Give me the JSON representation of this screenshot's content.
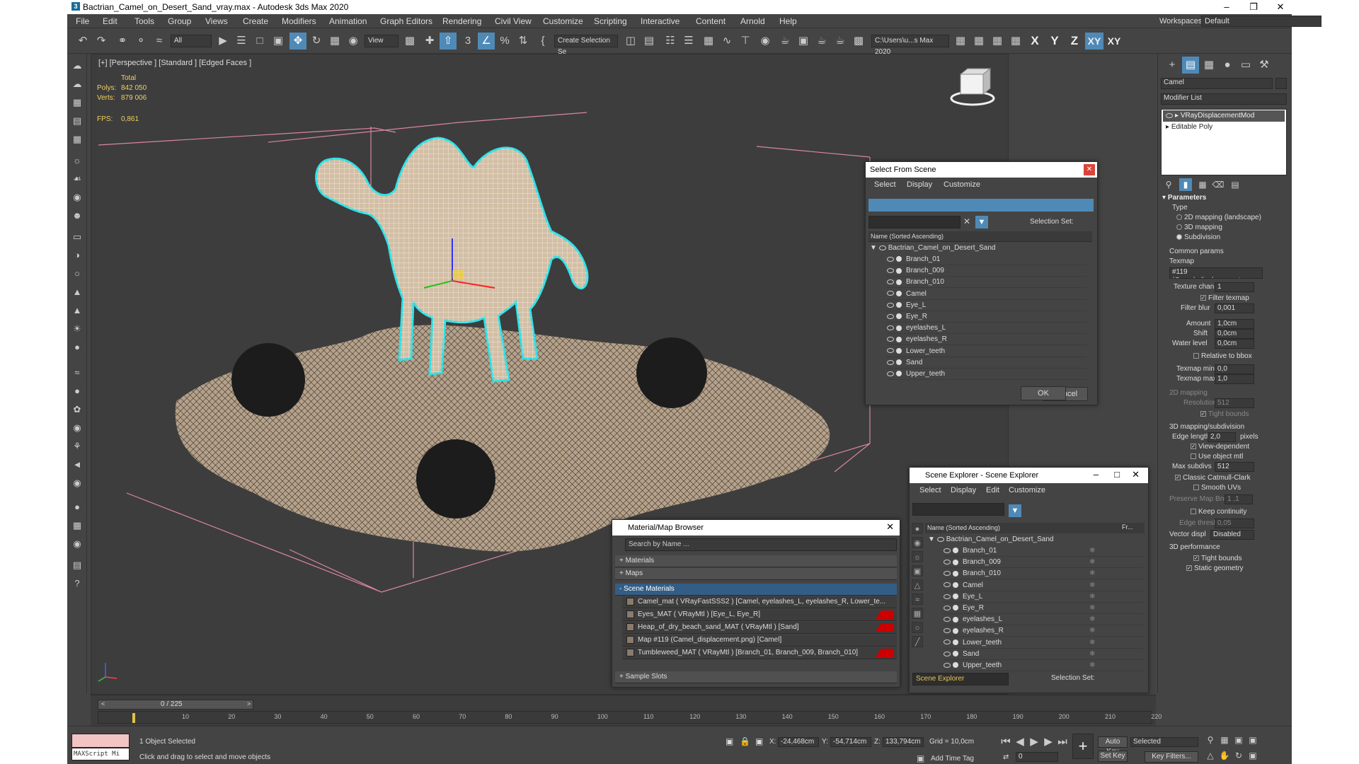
{
  "window": {
    "title": "Bactrian_Camel_on_Desert_Sand_vray.max - Autodesk 3ds Max 2020"
  },
  "menu": [
    "File",
    "Edit",
    "Tools",
    "Group",
    "Views",
    "Create",
    "Modifiers",
    "Animation",
    "Graph Editors",
    "Rendering",
    "Civil View",
    "Customize",
    "Scripting",
    "Interactive",
    "Content",
    "Arnold",
    "Help"
  ],
  "workspace": {
    "label": "Workspaces:",
    "value": "Default"
  },
  "toolbar": {
    "filter": "All",
    "view": "View",
    "selection_set": "Create Selection Se",
    "path": "C:\\Users\\u...s Max 2020",
    "axes": [
      "X",
      "Y",
      "Z",
      "XY",
      "XY"
    ]
  },
  "viewport": {
    "label": "[+] [Perspective ] [Standard ] [Edged Faces ]",
    "stats": {
      "total_label": "Total",
      "polys_label": "Polys:",
      "polys": "842 050",
      "verts_label": "Verts:",
      "verts": "879 006",
      "fps_label": "FPS:",
      "fps": "0,861"
    }
  },
  "select_from_scene": {
    "title": "Select From Scene",
    "menu": [
      "Select",
      "Display",
      "Customize"
    ],
    "selection_set_label": "Selection Set:",
    "column": "Name (Sorted Ascending)",
    "root": "Bactrian_Camel_on_Desert_Sand",
    "items": [
      "Branch_01",
      "Branch_009",
      "Branch_010",
      "Camel",
      "Eye_L",
      "Eye_R",
      "eyelashes_L",
      "eyelashes_R",
      "Lower_teeth",
      "Sand",
      "Upper_teeth"
    ],
    "ok": "OK",
    "cancel": "Cancel"
  },
  "scene_explorer": {
    "title": "Scene Explorer - Scene Explorer",
    "menu": [
      "Select",
      "Display",
      "Edit",
      "Customize"
    ],
    "column": "Name (Sorted Ascending)",
    "column2": "Fr...",
    "root": "Bactrian_Camel_on_Desert_Sand",
    "items": [
      "Branch_01",
      "Branch_009",
      "Branch_010",
      "Camel",
      "Eye_L",
      "Eye_R",
      "eyelashes_L",
      "eyelashes_R",
      "Lower_teeth",
      "Sand",
      "Upper_teeth"
    ],
    "footer": "Scene Explorer",
    "selection_set_label": "Selection Set:"
  },
  "material_browser": {
    "title": "Material/Map Browser",
    "search_placeholder": "Search by Name ...",
    "groups": {
      "materials": "+ Materials",
      "maps": "+ Maps",
      "scene": "- Scene Materials",
      "sample": "+ Sample Slots"
    },
    "scene_materials": [
      "Camel_mat  ( VRayFastSSS2 )  [Camel, eyelashes_L, eyelashes_R, Lower_te...",
      "Eyes_MAT  ( VRayMtl )  [Eye_L, Eye_R]",
      "Heap_of_dry_beach_sand_MAT  ( VRayMtl )  [Sand]",
      "Map #119 (Camel_displacement.png)  [Camel]",
      "Tumbleweed_MAT  ( VRayMtl )  [Branch_01, Branch_009, Branch_010]"
    ]
  },
  "command_panel": {
    "object_name": "Camel",
    "modifier_list": "Modifier List",
    "stack": [
      "VRayDisplacementMod",
      "Editable Poly"
    ],
    "parameters": "Parameters",
    "type_label": "Type",
    "type_options": [
      "2D mapping (landscape)",
      "3D mapping",
      "Subdivision"
    ],
    "common": "Common params",
    "texmap_label": "Texmap",
    "texmap": "#119 (Camel_displacement.p",
    "texture_chan_label": "Texture chan",
    "texture_chan": "1",
    "filter_texmap": "Filter texmap",
    "filter_blur_label": "Filter blur",
    "filter_blur": "0,001",
    "amount_label": "Amount",
    "amount": "1,0cm",
    "shift_label": "Shift",
    "shift": "0,0cm",
    "water_label": "Water level",
    "water": "0,0cm",
    "relative_bbox": "Relative to bbox",
    "texmap_min_label": "Texmap min",
    "texmap_min": "0,0",
    "texmap_max_label": "Texmap max",
    "texmap_max": "1,0",
    "mapping2d": "2D mapping",
    "resolution_label": "Resolution",
    "resolution": "512",
    "tight_bounds": "Tight bounds",
    "mapping3d": "3D mapping/subdivision",
    "edge_length_label": "Edge length",
    "edge_length": "2,0",
    "pixels": "pixels",
    "view_dependent": "View-dependent",
    "use_object_mtl": "Use object mtl",
    "max_subdivs_label": "Max subdivs",
    "max_subdivs": "512",
    "catmull": "Classic Catmull-Clark",
    "smooth_uvs": "Smooth UVs",
    "preserve_label": "Preserve Map Bnd",
    "preserve": "1 ,1",
    "keep_continuity": "Keep continuity",
    "edge_thresh_label": "Edge thresh",
    "edge_thresh": "0,05",
    "vector_label": "Vector displ",
    "vector": "Disabled",
    "perf": "3D performance",
    "tight_bounds2": "Tight bounds",
    "static_geometry": "Static geometry"
  },
  "timeline": {
    "frame": "0 / 225",
    "ticks": [
      "10",
      "20",
      "30",
      "40",
      "50",
      "60",
      "70",
      "80",
      "90",
      "100",
      "110",
      "120",
      "130",
      "140",
      "150",
      "160",
      "170",
      "180",
      "190",
      "200",
      "210",
      "220"
    ]
  },
  "status": {
    "maxscript": "MAXScript Mi",
    "selected": "1 Object Selected",
    "hint": "Click and drag to select and move objects",
    "x_label": "X:",
    "x": "-24,468cm",
    "y_label": "Y:",
    "y": "-54,714cm",
    "z_label": "Z:",
    "z": "133,794cm",
    "grid": "Grid = 10,0cm",
    "add_time_tag": "Add Time Tag",
    "auto_key": "Auto Key",
    "set_key": "Set Key",
    "selected_dd": "Selected",
    "key_filters": "Key Filters...",
    "frame_value": "0"
  }
}
